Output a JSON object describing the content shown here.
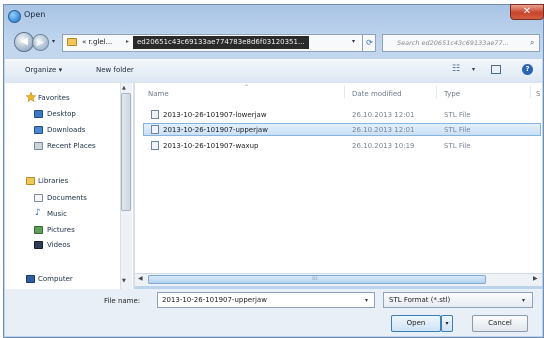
{
  "window": {
    "title": "Open",
    "close_glyph": "✕"
  },
  "navigation": {
    "back_glyph": "◀",
    "forward_glyph": "▶",
    "dropdown_glyph": "▾",
    "breadcrumb": [
      "« r.glel...",
      "ed20651c43c69133ae774783e8d6f03120351..."
    ],
    "crumb_sep": "▸",
    "refresh_glyph": "⟳",
    "search_placeholder": "Search ed20651c43c69133ae77...",
    "search_glyph": "⌕"
  },
  "toolbar": {
    "organize_label": "Organize ▾",
    "new_folder_label": "New folder",
    "views_glyph": "☷",
    "help_glyph": "?"
  },
  "sidebar": {
    "favorites_label": "Favorites",
    "favorites": [
      {
        "label": "Desktop",
        "icon": "desktop-icon"
      },
      {
        "label": "Downloads",
        "icon": "downloads-icon"
      },
      {
        "label": "Recent Places",
        "icon": "recent-places-icon"
      }
    ],
    "libraries_label": "Libraries",
    "libraries": [
      {
        "label": "Documents",
        "icon": "documents-icon"
      },
      {
        "label": "Music",
        "icon": "music-icon"
      },
      {
        "label": "Pictures",
        "icon": "pictures-icon"
      },
      {
        "label": "Videos",
        "icon": "videos-icon"
      }
    ],
    "computer_label": "Computer"
  },
  "file_list": {
    "columns": [
      "Name",
      "Date modified",
      "Type",
      "S"
    ],
    "sort_glyph": "⌃",
    "rows": [
      {
        "name": "2013-10-26-101907-lowerjaw",
        "date": "26.10.2013 12:01",
        "type": "STL File",
        "selected": false
      },
      {
        "name": "2013-10-26-101907-upperjaw",
        "date": "26.10.2013 12:01",
        "type": "STL File",
        "selected": true
      },
      {
        "name": "2013-10-26-101907-waxup",
        "date": "26.10.2013 10:19",
        "type": "STL File",
        "selected": false
      }
    ]
  },
  "scroll": {
    "up": "▲",
    "down": "▼",
    "left": "◀",
    "right": "▶",
    "grip": "⁞⁞⁞"
  },
  "footer": {
    "filename_label": "File name:",
    "filename_value": "2013-10-26-101907-upperjaw",
    "filetype_value": "STL Format (*.stl)",
    "open_label": "Open",
    "split_glyph": "▾",
    "cancel_label": "Cancel"
  }
}
